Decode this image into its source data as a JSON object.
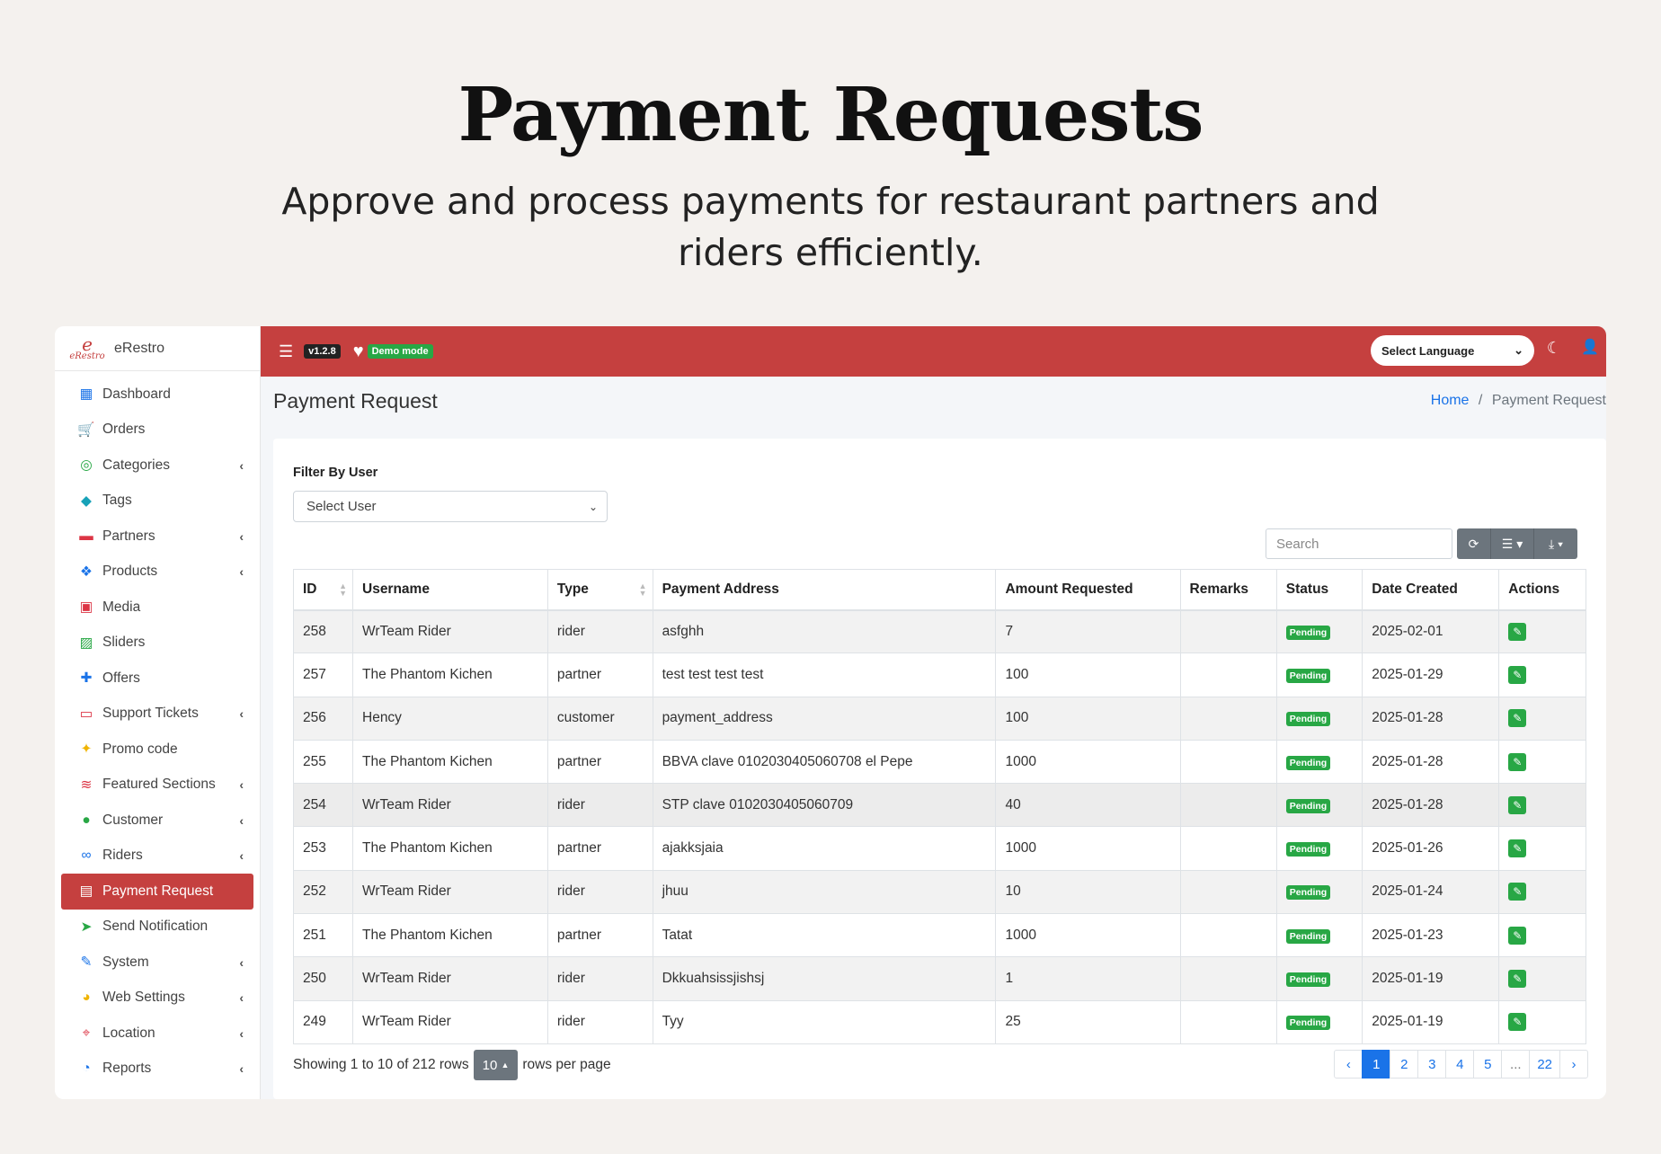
{
  "hero": {
    "title": "Payment Requests",
    "subtitle": "Approve and process payments for restaurant partners and riders efficiently."
  },
  "brand": {
    "logo_text": "e",
    "logo_sub": "eRestro",
    "name": "eRestro"
  },
  "sidebar": {
    "items": [
      {
        "label": "Dashboard",
        "icon": "dashboard-icon",
        "color": "#1a73e8",
        "glyph": "▦",
        "chev": ""
      },
      {
        "label": "Orders",
        "icon": "cart-icon",
        "color": "#f0b400",
        "glyph": "🛒",
        "chev": ""
      },
      {
        "label": "Categories",
        "icon": "target-icon",
        "color": "#28a745",
        "glyph": "◎",
        "chev": "‹"
      },
      {
        "label": "Tags",
        "icon": "tag-icon",
        "color": "#17a2b8",
        "glyph": "◆",
        "chev": ""
      },
      {
        "label": "Partners",
        "icon": "store-icon",
        "color": "#dc3545",
        "glyph": "▬",
        "chev": "‹"
      },
      {
        "label": "Products",
        "icon": "cubes-icon",
        "color": "#1a73e8",
        "glyph": "❖",
        "chev": "‹"
      },
      {
        "label": "Media",
        "icon": "media-icon",
        "color": "#dc3545",
        "glyph": "▣",
        "chev": ""
      },
      {
        "label": "Sliders",
        "icon": "image-icon",
        "color": "#28a745",
        "glyph": "▨",
        "chev": ""
      },
      {
        "label": "Offers",
        "icon": "gift-icon",
        "color": "#1a73e8",
        "glyph": "✚",
        "chev": ""
      },
      {
        "label": "Support Tickets",
        "icon": "ticket-icon",
        "color": "#dc3545",
        "glyph": "▭",
        "chev": "‹"
      },
      {
        "label": "Promo code",
        "icon": "puzzle-icon",
        "color": "#f0b400",
        "glyph": "✦",
        "chev": ""
      },
      {
        "label": "Featured Sections",
        "icon": "layers-icon",
        "color": "#dc3545",
        "glyph": "≋",
        "chev": "‹"
      },
      {
        "label": "Customer",
        "icon": "user-icon",
        "color": "#28a745",
        "glyph": "●",
        "chev": "‹"
      },
      {
        "label": "Riders",
        "icon": "motorcycle-icon",
        "color": "#1a73e8",
        "glyph": "∞",
        "chev": "‹"
      },
      {
        "label": "Payment Request",
        "icon": "money-icon",
        "color": "#ffffff",
        "glyph": "▤",
        "chev": "",
        "active": true
      },
      {
        "label": "Send Notification",
        "icon": "paper-plane-icon",
        "color": "#28a745",
        "glyph": "➤",
        "chev": ""
      },
      {
        "label": "System",
        "icon": "wrench-icon",
        "color": "#1a73e8",
        "glyph": "✎",
        "chev": "‹"
      },
      {
        "label": "Web Settings",
        "icon": "palette-icon",
        "color": "#f0b400",
        "glyph": "◕",
        "chev": "‹"
      },
      {
        "label": "Location",
        "icon": "map-icon",
        "color": "#dc3545",
        "glyph": "⌖",
        "chev": "‹"
      },
      {
        "label": "Reports",
        "icon": "pie-chart-icon",
        "color": "#1a73e8",
        "glyph": "◔",
        "chev": "‹"
      }
    ]
  },
  "topbar": {
    "version": "v1.2.8",
    "demo": "Demo mode",
    "language_select": "Select Language",
    "accent": "#c5403f"
  },
  "page": {
    "title": "Payment Request",
    "breadcrumb_home": "Home",
    "breadcrumb_sep": "/",
    "breadcrumb_current": "Payment Request"
  },
  "filter": {
    "label": "Filter By User",
    "select_value": "Select User"
  },
  "search": {
    "placeholder": "Search"
  },
  "table": {
    "columns": [
      "ID",
      "Username",
      "Type",
      "Payment Address",
      "Amount Requested",
      "Remarks",
      "Status",
      "Date Created",
      "Actions"
    ],
    "rows": [
      {
        "id": "258",
        "username": "WrTeam Rider",
        "type": "rider",
        "address": "asfghh",
        "amount": "7",
        "remarks": "",
        "status": "Pending",
        "date": "2025-02-01"
      },
      {
        "id": "257",
        "username": "The Phantom Kichen",
        "type": "partner",
        "address": "test test test test",
        "amount": "100",
        "remarks": "",
        "status": "Pending",
        "date": "2025-01-29"
      },
      {
        "id": "256",
        "username": "Hency",
        "type": "customer",
        "address": "payment_address",
        "amount": "100",
        "remarks": "",
        "status": "Pending",
        "date": "2025-01-28"
      },
      {
        "id": "255",
        "username": "The Phantom Kichen",
        "type": "partner",
        "address": "BBVA clave 0102030405060708 el Pepe",
        "amount": "1000",
        "remarks": "",
        "status": "Pending",
        "date": "2025-01-28"
      },
      {
        "id": "254",
        "username": "WrTeam Rider",
        "type": "rider",
        "address": "STP clave 0102030405060709",
        "amount": "40",
        "remarks": "",
        "status": "Pending",
        "date": "2025-01-28"
      },
      {
        "id": "253",
        "username": "The Phantom Kichen",
        "type": "partner",
        "address": "ajakksjaia",
        "amount": "1000",
        "remarks": "",
        "status": "Pending",
        "date": "2025-01-26"
      },
      {
        "id": "252",
        "username": "WrTeam Rider",
        "type": "rider",
        "address": "jhuu",
        "amount": "10",
        "remarks": "",
        "status": "Pending",
        "date": "2025-01-24"
      },
      {
        "id": "251",
        "username": "The Phantom Kichen",
        "type": "partner",
        "address": "Tatat",
        "amount": "1000",
        "remarks": "",
        "status": "Pending",
        "date": "2025-01-23"
      },
      {
        "id": "250",
        "username": "WrTeam Rider",
        "type": "rider",
        "address": "Dkkuahsissjishsj",
        "amount": "1",
        "remarks": "",
        "status": "Pending",
        "date": "2025-01-19"
      },
      {
        "id": "249",
        "username": "WrTeam Rider",
        "type": "rider",
        "address": "Tyy",
        "amount": "25",
        "remarks": "",
        "status": "Pending",
        "date": "2025-01-19"
      }
    ]
  },
  "footer": {
    "showing": "Showing 1 to 10 of 212 rows",
    "page_size": "10",
    "rows_per_page": "rows per page",
    "pages": [
      "‹",
      "1",
      "2",
      "3",
      "4",
      "5",
      "...",
      "22",
      "›"
    ],
    "active_page": "1"
  }
}
